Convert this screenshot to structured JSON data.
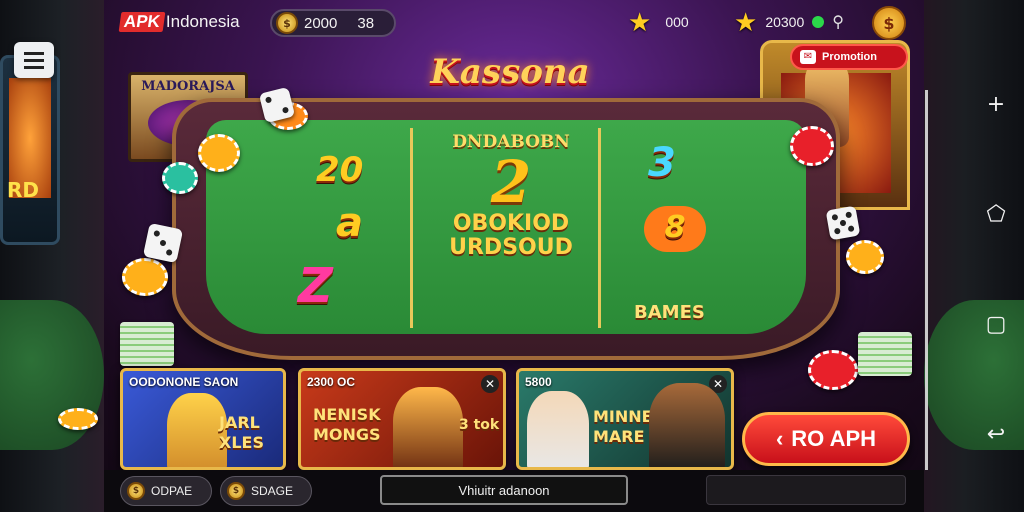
{
  "header": {
    "logo_brand": "APK",
    "logo_text": "Indonesia",
    "coin_amount": "2000",
    "coin_suffix": "38",
    "star_value": "000",
    "star_value2": "20300",
    "promo_label": "Promotion"
  },
  "game": {
    "title": "Kassona",
    "tiles": {
      "t1": "20",
      "t2": "a",
      "t3": "Z",
      "t4": "3",
      "t5": "8"
    },
    "center_top": "DNDABOBN",
    "center_big": "2",
    "center_line1": "OBOKIOD",
    "center_line2": "URDSOUD",
    "games_label": "BAMES"
  },
  "cards": [
    {
      "caption": "OODONONE SAON",
      "headline": "JARL XLES"
    },
    {
      "caption": "2300 OC",
      "headline": "NENISK MONGS",
      "badge": "3 tok"
    },
    {
      "caption": "5800",
      "headline": "MINNE MARE"
    }
  ],
  "play_button": {
    "label": "RO APH",
    "icon": "chevron-left-icon"
  },
  "bottom": {
    "pill1": "ODPAE",
    "pill2": "SDAGE",
    "center_text": "Vhiuitr adanoon"
  },
  "side_nav": [
    "plus-icon",
    "pentagon-icon",
    "box-icon",
    "chevron-icon"
  ],
  "colors": {
    "accent": "#ffcc22",
    "brand_red": "#e22c2c",
    "felt": "#2a8a36"
  }
}
